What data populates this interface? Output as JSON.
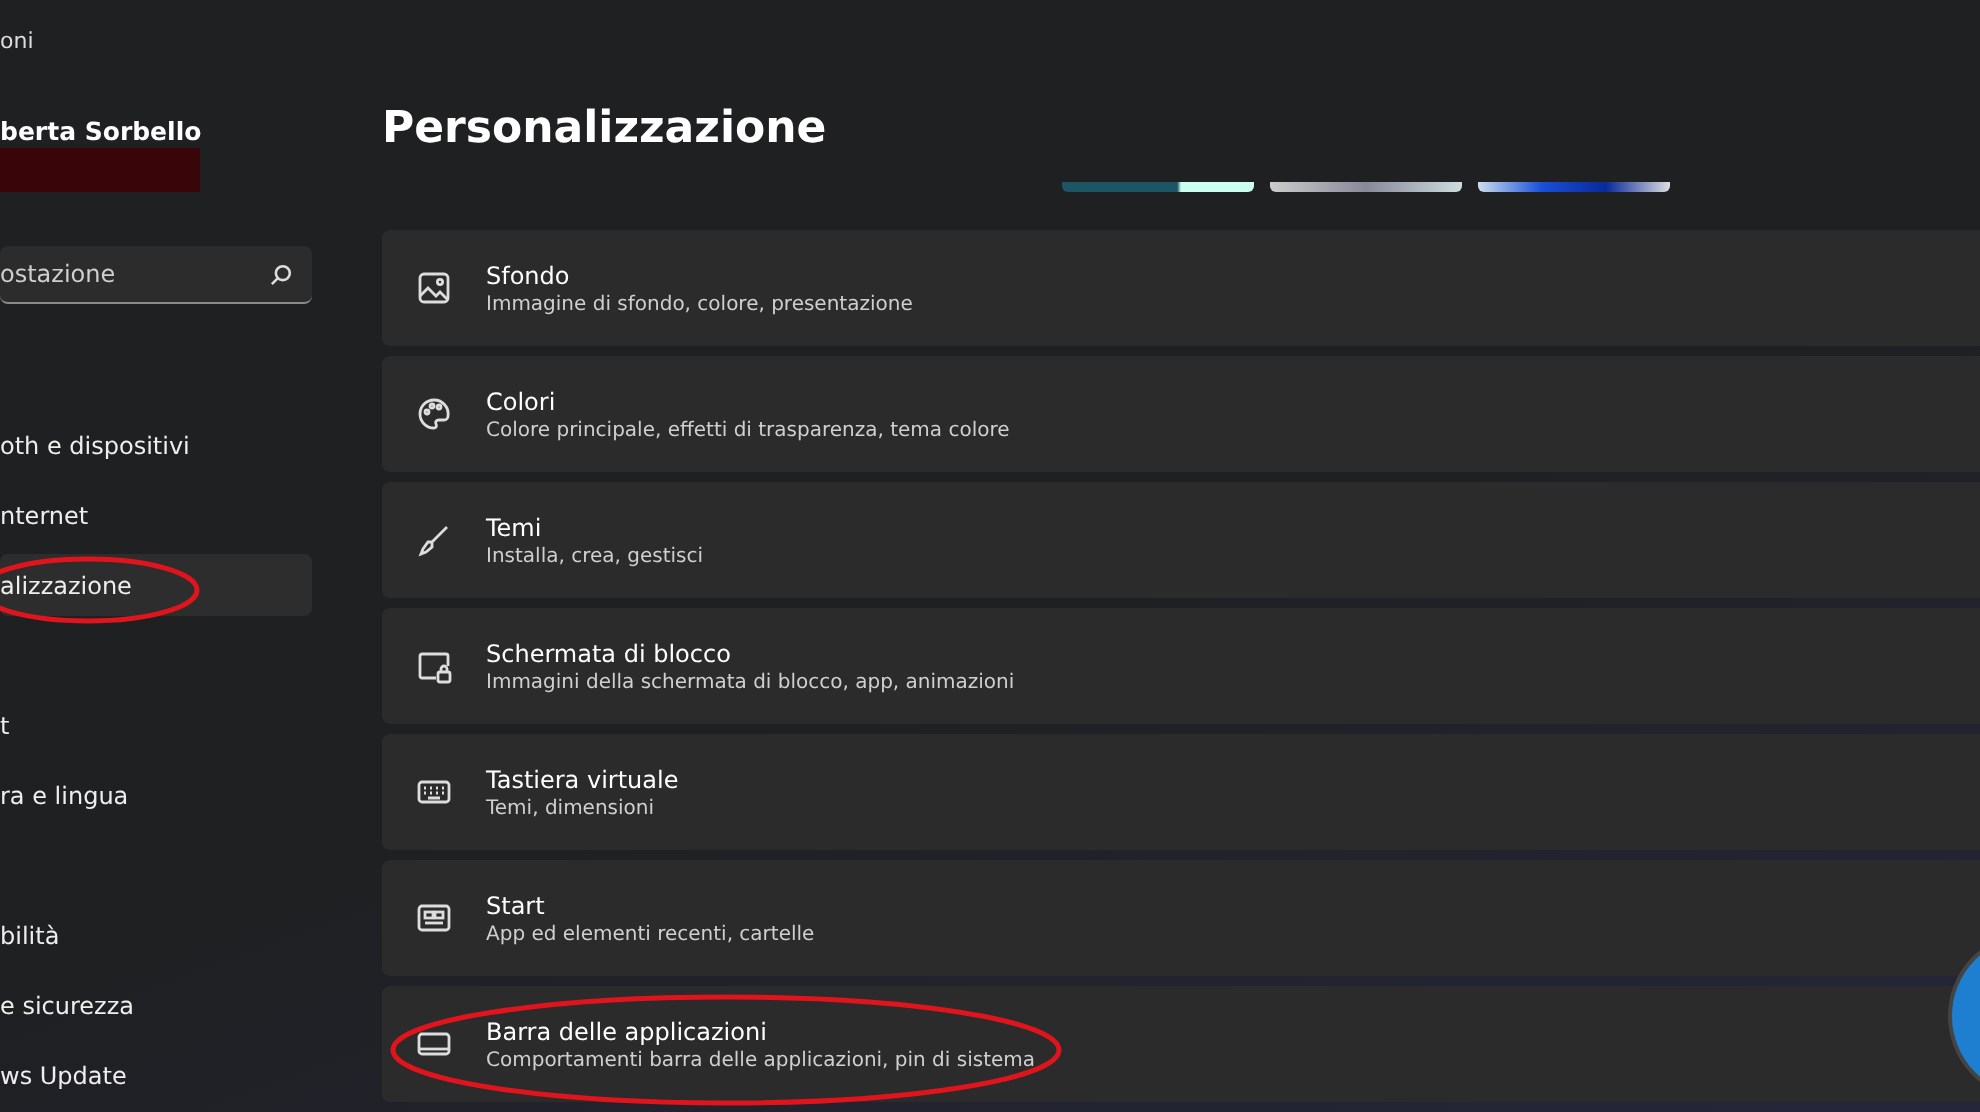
{
  "window": {
    "title": "oni"
  },
  "profile": {
    "name": "berta Sorbello"
  },
  "search": {
    "placeholder": "ostazione"
  },
  "sidebar": {
    "groups": [
      {
        "items": [
          {
            "label": "oth e dispositivi",
            "selected": false,
            "circled": false
          },
          {
            "label": "nternet",
            "selected": false,
            "circled": false
          },
          {
            "label": "alizzazione",
            "selected": true,
            "circled": true
          }
        ]
      },
      {
        "items": [
          {
            "label": "t",
            "selected": false,
            "circled": false
          },
          {
            "label": "ra e lingua",
            "selected": false,
            "circled": false
          }
        ]
      },
      {
        "items": [
          {
            "label": "bilità",
            "selected": false,
            "circled": false
          },
          {
            "label": "e sicurezza",
            "selected": false,
            "circled": false
          },
          {
            "label": "ws Update",
            "selected": false,
            "circled": false
          }
        ]
      }
    ]
  },
  "page": {
    "title": "Personalizzazione"
  },
  "settings": [
    {
      "kind": "picture",
      "title": "Sfondo",
      "subtitle": "Immagine di sfondo, colore, presentazione",
      "circled": false
    },
    {
      "kind": "palette",
      "title": "Colori",
      "subtitle": "Colore principale, effetti di trasparenza, tema colore",
      "circled": false
    },
    {
      "kind": "brush",
      "title": "Temi",
      "subtitle": "Installa, crea, gestisci",
      "circled": false
    },
    {
      "kind": "lockscreen",
      "title": "Schermata di blocco",
      "subtitle": "Immagini della schermata di blocco, app, animazioni",
      "circled": false
    },
    {
      "kind": "keyboard",
      "title": "Tastiera virtuale",
      "subtitle": "Temi, dimensioni",
      "circled": false
    },
    {
      "kind": "start",
      "title": "Start",
      "subtitle": "App ed elementi recenti, cartelle",
      "circled": false
    },
    {
      "kind": "taskbar",
      "title": "Barra delle applicazioni",
      "subtitle": "Comportamenti barra delle applicazioni, pin di sistema",
      "circled": true
    }
  ]
}
